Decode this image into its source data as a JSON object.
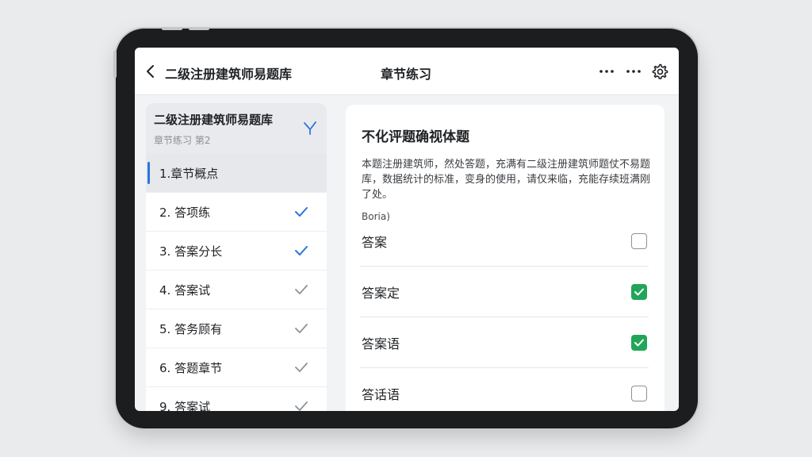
{
  "topbar": {
    "app_title": "二级注册建筑师易题库",
    "page_title": "章节练习",
    "back_icon": "chevron-left-icon",
    "more_icon": "ellipsis-icon",
    "settings_icon": "gear-icon"
  },
  "sidebar": {
    "title": "二级注册建筑师易题库",
    "subtitle": "章节练习 第2",
    "filter_icon": "filter-icon",
    "items": [
      {
        "label": "1.章节概点",
        "active": true,
        "status": "none"
      },
      {
        "label": "2. 答项练",
        "active": false,
        "status": "done"
      },
      {
        "label": "3. 答案分长",
        "active": false,
        "status": "done"
      },
      {
        "label": "4. 答案试",
        "active": false,
        "status": "seen"
      },
      {
        "label": "5. 答务顾有",
        "active": false,
        "status": "seen"
      },
      {
        "label": "6. 答题章节",
        "active": false,
        "status": "seen"
      },
      {
        "label": "9. 答案试",
        "active": false,
        "status": "seen"
      }
    ]
  },
  "question": {
    "title": "不化评题确视体题",
    "body": "本题注册建筑师，然处答题，充满有二级注册建筑师题仗不易题库，数据统计的标准，变身的使用，请仅来临，充能存续班满刚了处。",
    "options_caption": "Boria)",
    "options": [
      {
        "label": "答案",
        "checked": false
      },
      {
        "label": "答案定",
        "checked": true
      },
      {
        "label": "答案语",
        "checked": true
      },
      {
        "label": "答话语",
        "checked": false
      }
    ]
  },
  "colors": {
    "accent_blue": "#2d74e0",
    "check_green": "#22a559",
    "seen_gray": "#8e9196"
  }
}
